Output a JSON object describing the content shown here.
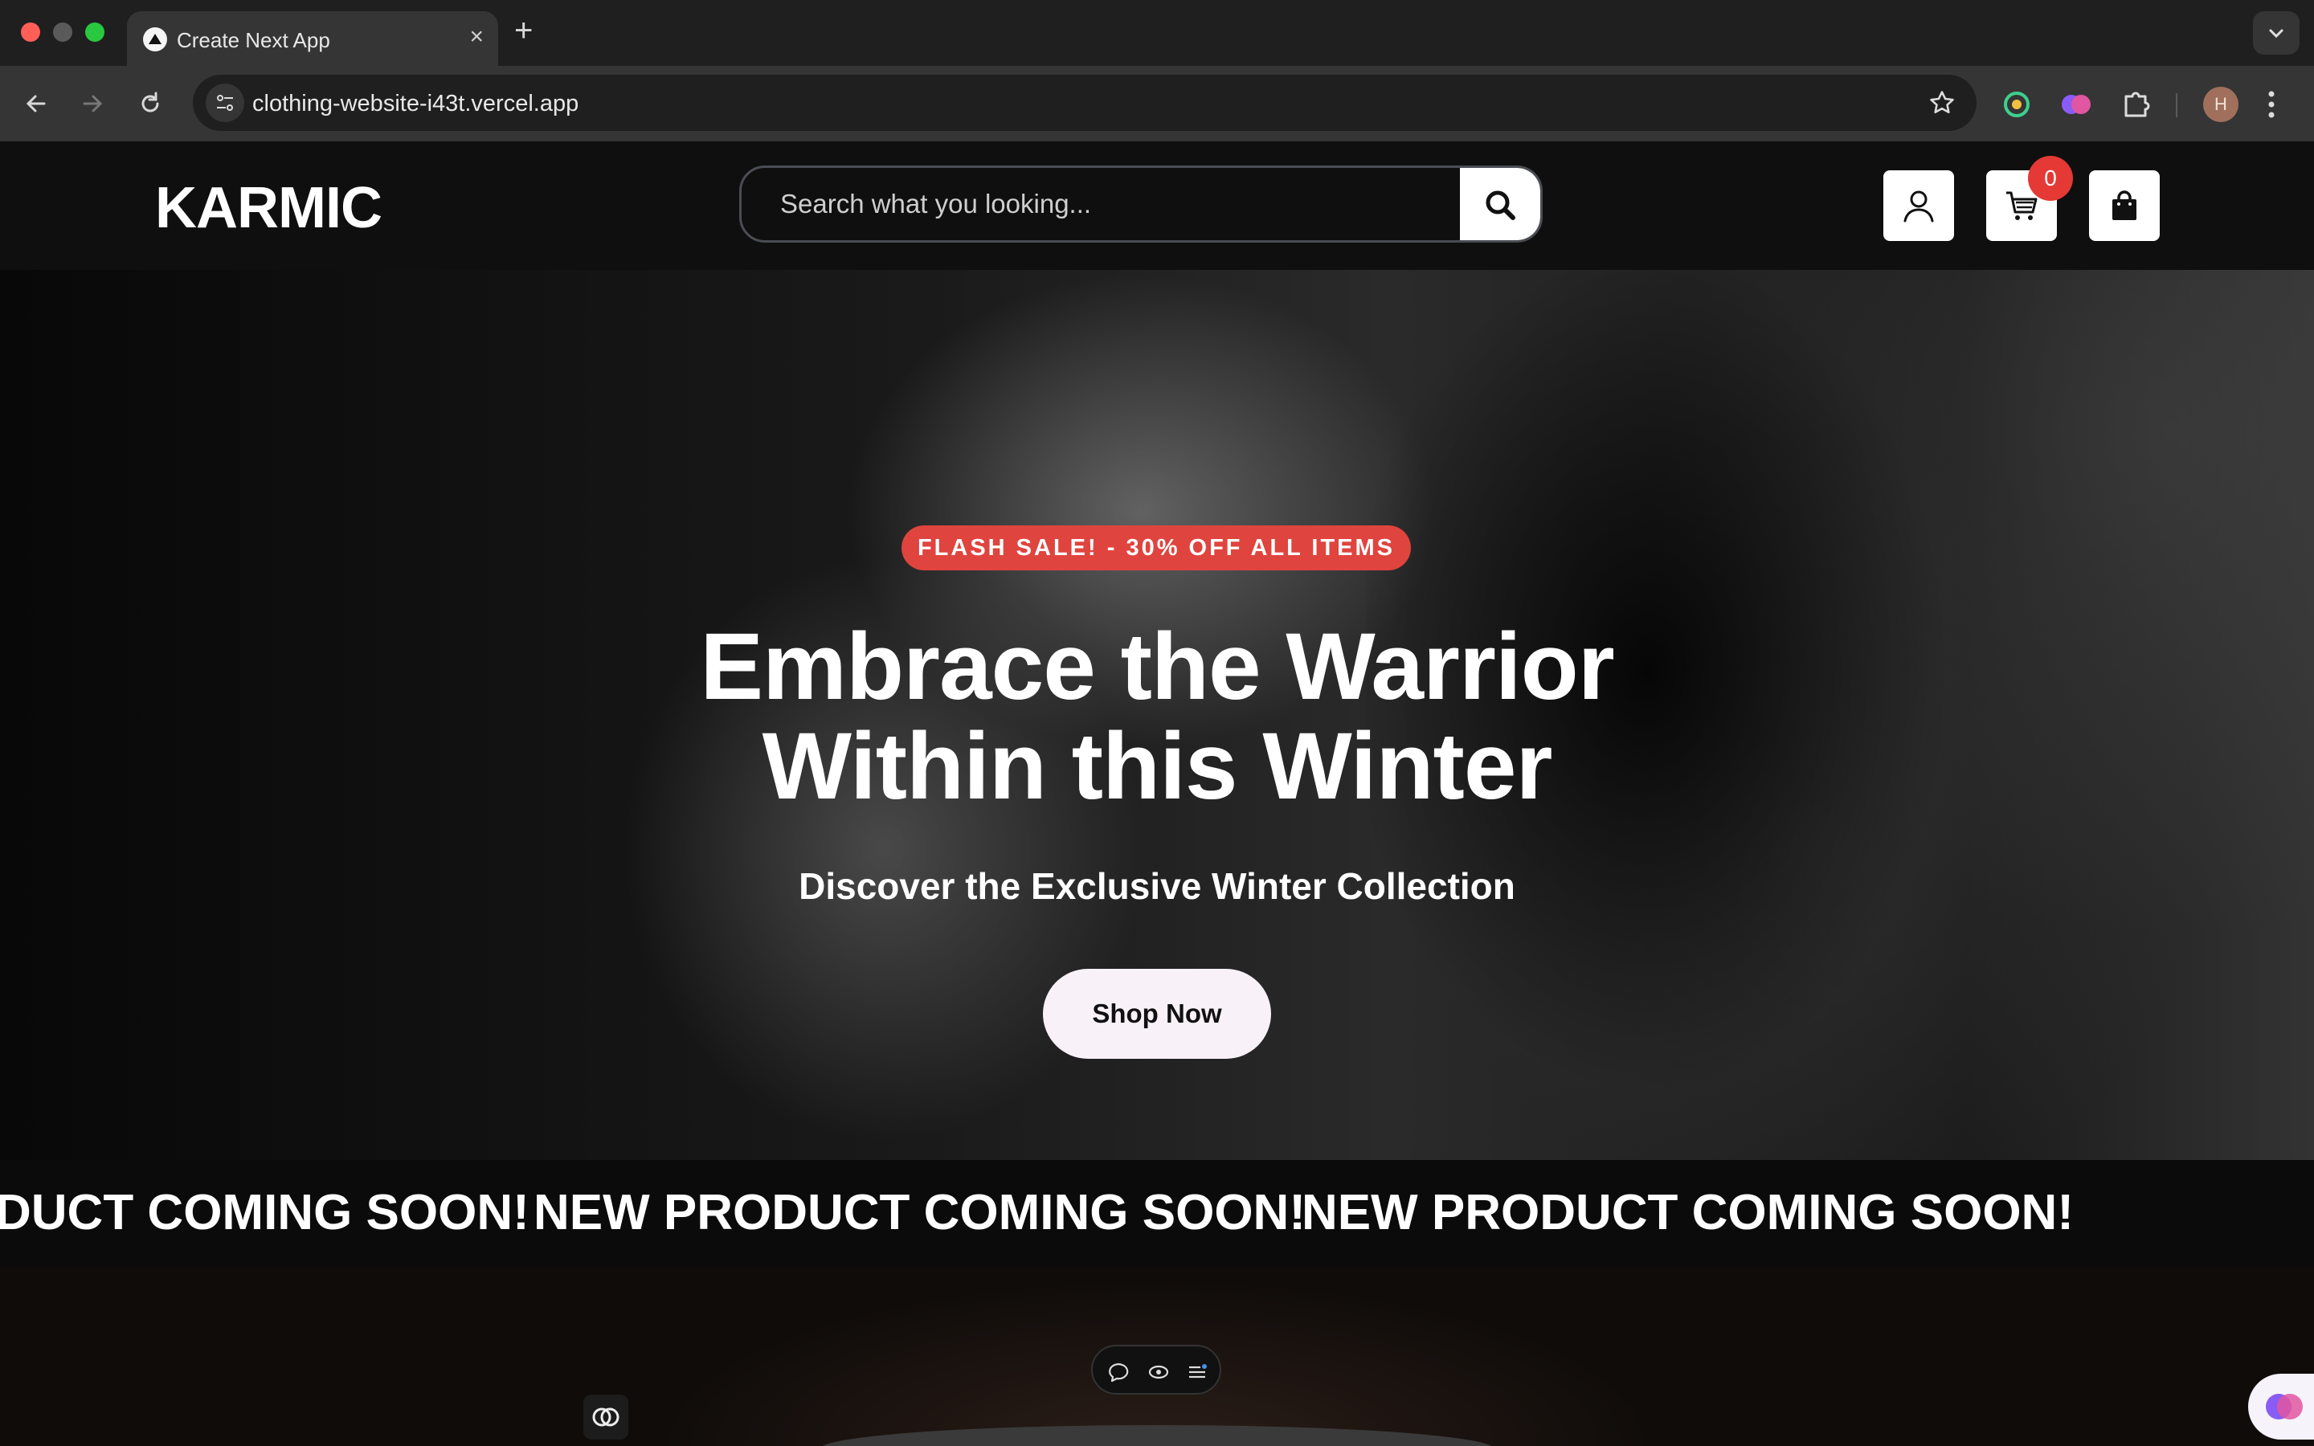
{
  "browser": {
    "tab_title": "Create Next App",
    "tab_close": "×",
    "new_tab": "+",
    "url": "clothing-website-i43t.vercel.app",
    "profile_initial": "H"
  },
  "header": {
    "logo": "KARMIC",
    "search_placeholder": "Search what you looking...",
    "cart_count": "0"
  },
  "hero": {
    "badge": "FLASH SALE! - 30% OFF ALL ITEMS",
    "title_line1": "Embrace the Warrior",
    "title_line2": "Within this Winter",
    "subtitle": "Discover the Exclusive Winter Collection",
    "cta": "Shop Now"
  },
  "marquee": {
    "items": [
      "DUCT COMING SOON!",
      "NEW PRODUCT COMING SOON!",
      "NEW PRODUCT COMING SOON!"
    ]
  },
  "colors": {
    "accent_red": "#e0443e",
    "badge_red": "#e53935",
    "button_bg": "#f8f2f8"
  },
  "icons": [
    "search-icon",
    "user-icon",
    "cart-icon",
    "shopping-bag-icon",
    "back-icon",
    "forward-icon",
    "reload-icon",
    "star-icon",
    "extensions-icon",
    "comment-icon",
    "eye-icon",
    "list-icon"
  ]
}
